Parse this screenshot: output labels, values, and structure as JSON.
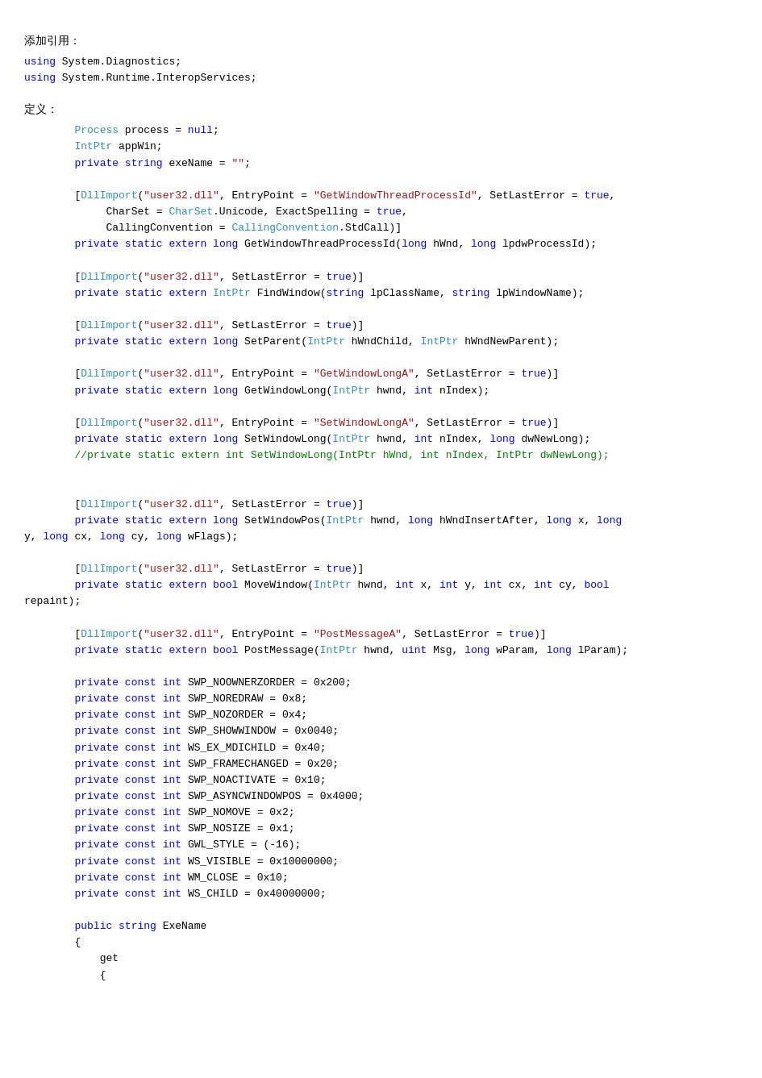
{
  "sections": [
    {
      "id": "add-reference",
      "title": "添加引用："
    },
    {
      "id": "definition",
      "title": "定义："
    }
  ],
  "using_lines": [
    "using System.Diagnostics;",
    "using System.Runtime.InteropServices;"
  ],
  "code_content": "code block"
}
